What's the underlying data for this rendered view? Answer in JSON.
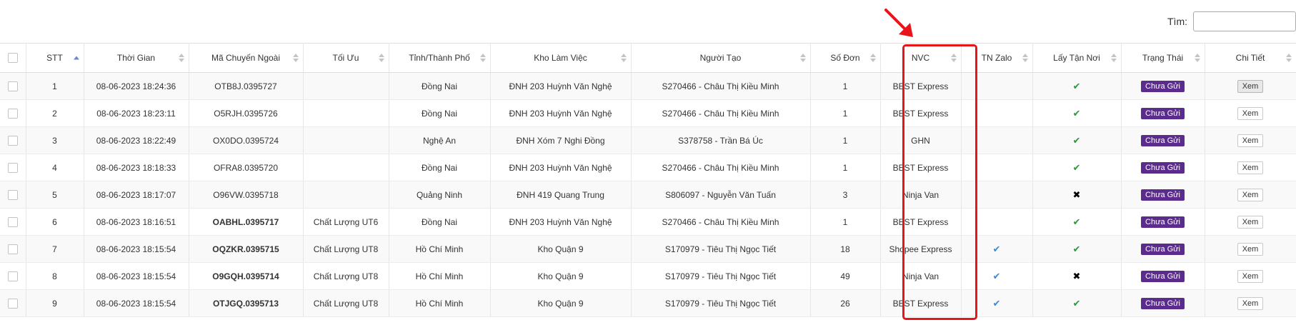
{
  "search": {
    "label": "Tìm:",
    "value": "",
    "placeholder": ""
  },
  "columns": [
    {
      "label": "",
      "sort": "none"
    },
    {
      "label": "STT",
      "sort": "asc"
    },
    {
      "label": "Thời Gian",
      "sort": "both"
    },
    {
      "label": "Mã Chuyến Ngoài",
      "sort": "both"
    },
    {
      "label": "Tối Ưu",
      "sort": "both"
    },
    {
      "label": "Tỉnh/Thành Phố",
      "sort": "both"
    },
    {
      "label": "Kho Làm Việc",
      "sort": "both"
    },
    {
      "label": "Người Tạo",
      "sort": "both"
    },
    {
      "label": "Số Đơn",
      "sort": "both"
    },
    {
      "label": "NVC",
      "sort": "both"
    },
    {
      "label": "TN Zalo",
      "sort": "both"
    },
    {
      "label": "Lấy Tận Nơi",
      "sort": "both"
    },
    {
      "label": "Trạng Thái",
      "sort": "both"
    },
    {
      "label": "Chi Tiết",
      "sort": "both"
    }
  ],
  "rows": [
    {
      "stt": "1",
      "time": "08-06-2023 18:24:36",
      "code": "OTB8J.0395727",
      "code_highlight": false,
      "toi_uu": "",
      "city": "Đồng Nai",
      "warehouse": "ĐNH 203 Huỳnh Văn Nghệ",
      "creator": "S270466 - Châu Thị Kiều Minh",
      "so_don": "1",
      "nvc": "BEST Express",
      "zalo": "",
      "pickup": "check",
      "status": "Chưa Gửi",
      "detail": "Xem",
      "detail_active": true
    },
    {
      "stt": "2",
      "time": "08-06-2023 18:23:11",
      "code": "O5RJH.0395726",
      "code_highlight": false,
      "toi_uu": "",
      "city": "Đồng Nai",
      "warehouse": "ĐNH 203 Huỳnh Văn Nghệ",
      "creator": "S270466 - Châu Thị Kiều Minh",
      "so_don": "1",
      "nvc": "BEST Express",
      "zalo": "",
      "pickup": "check",
      "status": "Chưa Gửi",
      "detail": "Xem",
      "detail_active": false
    },
    {
      "stt": "3",
      "time": "08-06-2023 18:22:49",
      "code": "OX0DO.0395724",
      "code_highlight": false,
      "toi_uu": "",
      "city": "Nghệ An",
      "warehouse": "ĐNH Xóm 7 Nghi Đồng",
      "creator": "S378758 - Trần Bá Úc",
      "so_don": "1",
      "nvc": "GHN",
      "zalo": "",
      "pickup": "check",
      "status": "Chưa Gửi",
      "detail": "Xem",
      "detail_active": false
    },
    {
      "stt": "4",
      "time": "08-06-2023 18:18:33",
      "code": "OFRA8.0395720",
      "code_highlight": false,
      "toi_uu": "",
      "city": "Đồng Nai",
      "warehouse": "ĐNH 203 Huỳnh Văn Nghệ",
      "creator": "S270466 - Châu Thị Kiều Minh",
      "so_don": "1",
      "nvc": "BEST Express",
      "zalo": "",
      "pickup": "check",
      "status": "Chưa Gửi",
      "detail": "Xem",
      "detail_active": false
    },
    {
      "stt": "5",
      "time": "08-06-2023 18:17:07",
      "code": "O96VW.0395718",
      "code_highlight": false,
      "toi_uu": "",
      "city": "Quảng Ninh",
      "warehouse": "ĐNH 419 Quang Trung",
      "creator": "S806097 - Nguyễn Văn Tuấn",
      "so_don": "3",
      "nvc": "Ninja Van",
      "zalo": "",
      "pickup": "cross",
      "status": "Chưa Gửi",
      "detail": "Xem",
      "detail_active": false
    },
    {
      "stt": "6",
      "time": "08-06-2023 18:16:51",
      "code": "OABHL.0395717",
      "code_highlight": true,
      "toi_uu": "Chất Lượng UT6",
      "city": "Đồng Nai",
      "warehouse": "ĐNH 203 Huỳnh Văn Nghệ",
      "creator": "S270466 - Châu Thị Kiều Minh",
      "so_don": "1",
      "nvc": "BEST Express",
      "zalo": "",
      "pickup": "check",
      "status": "Chưa Gửi",
      "detail": "Xem",
      "detail_active": false
    },
    {
      "stt": "7",
      "time": "08-06-2023 18:15:54",
      "code": "OQZKR.0395715",
      "code_highlight": true,
      "toi_uu": "Chất Lượng UT8",
      "city": "Hồ Chí Minh",
      "warehouse": "Kho Quận 9",
      "creator": "S170979 - Tiêu Thị Ngọc Tiết",
      "so_don": "18",
      "nvc": "Shopee Express",
      "zalo": "check",
      "pickup": "check",
      "status": "Chưa Gửi",
      "detail": "Xem",
      "detail_active": false
    },
    {
      "stt": "8",
      "time": "08-06-2023 18:15:54",
      "code": "O9GQH.0395714",
      "code_highlight": true,
      "toi_uu": "Chất Lượng UT8",
      "city": "Hồ Chí Minh",
      "warehouse": "Kho Quận 9",
      "creator": "S170979 - Tiêu Thị Ngọc Tiết",
      "so_don": "49",
      "nvc": "Ninja Van",
      "zalo": "check",
      "pickup": "cross",
      "status": "Chưa Gửi",
      "detail": "Xem",
      "detail_active": false
    },
    {
      "stt": "9",
      "time": "08-06-2023 18:15:54",
      "code": "OTJGQ.0395713",
      "code_highlight": true,
      "toi_uu": "Chất Lượng UT8",
      "city": "Hồ Chí Minh",
      "warehouse": "Kho Quận 9",
      "creator": "S170979 - Tiêu Thị Ngọc Tiết",
      "so_don": "26",
      "nvc": "BEST Express",
      "zalo": "check",
      "pickup": "check",
      "status": "Chưa Gửi",
      "detail": "Xem",
      "detail_active": false
    }
  ],
  "colors": {
    "code_green": "#27923a",
    "status_badge": "#5b2b8e",
    "pickup_check": "#2a9a3c",
    "zalo_check": "#3a8ad6",
    "annotation_red": "#e8141c"
  },
  "icons": {
    "check": "check-icon",
    "cross": "cross-icon",
    "sort": "sort-icon",
    "annotation_arrow": "red-arrow-icon"
  }
}
